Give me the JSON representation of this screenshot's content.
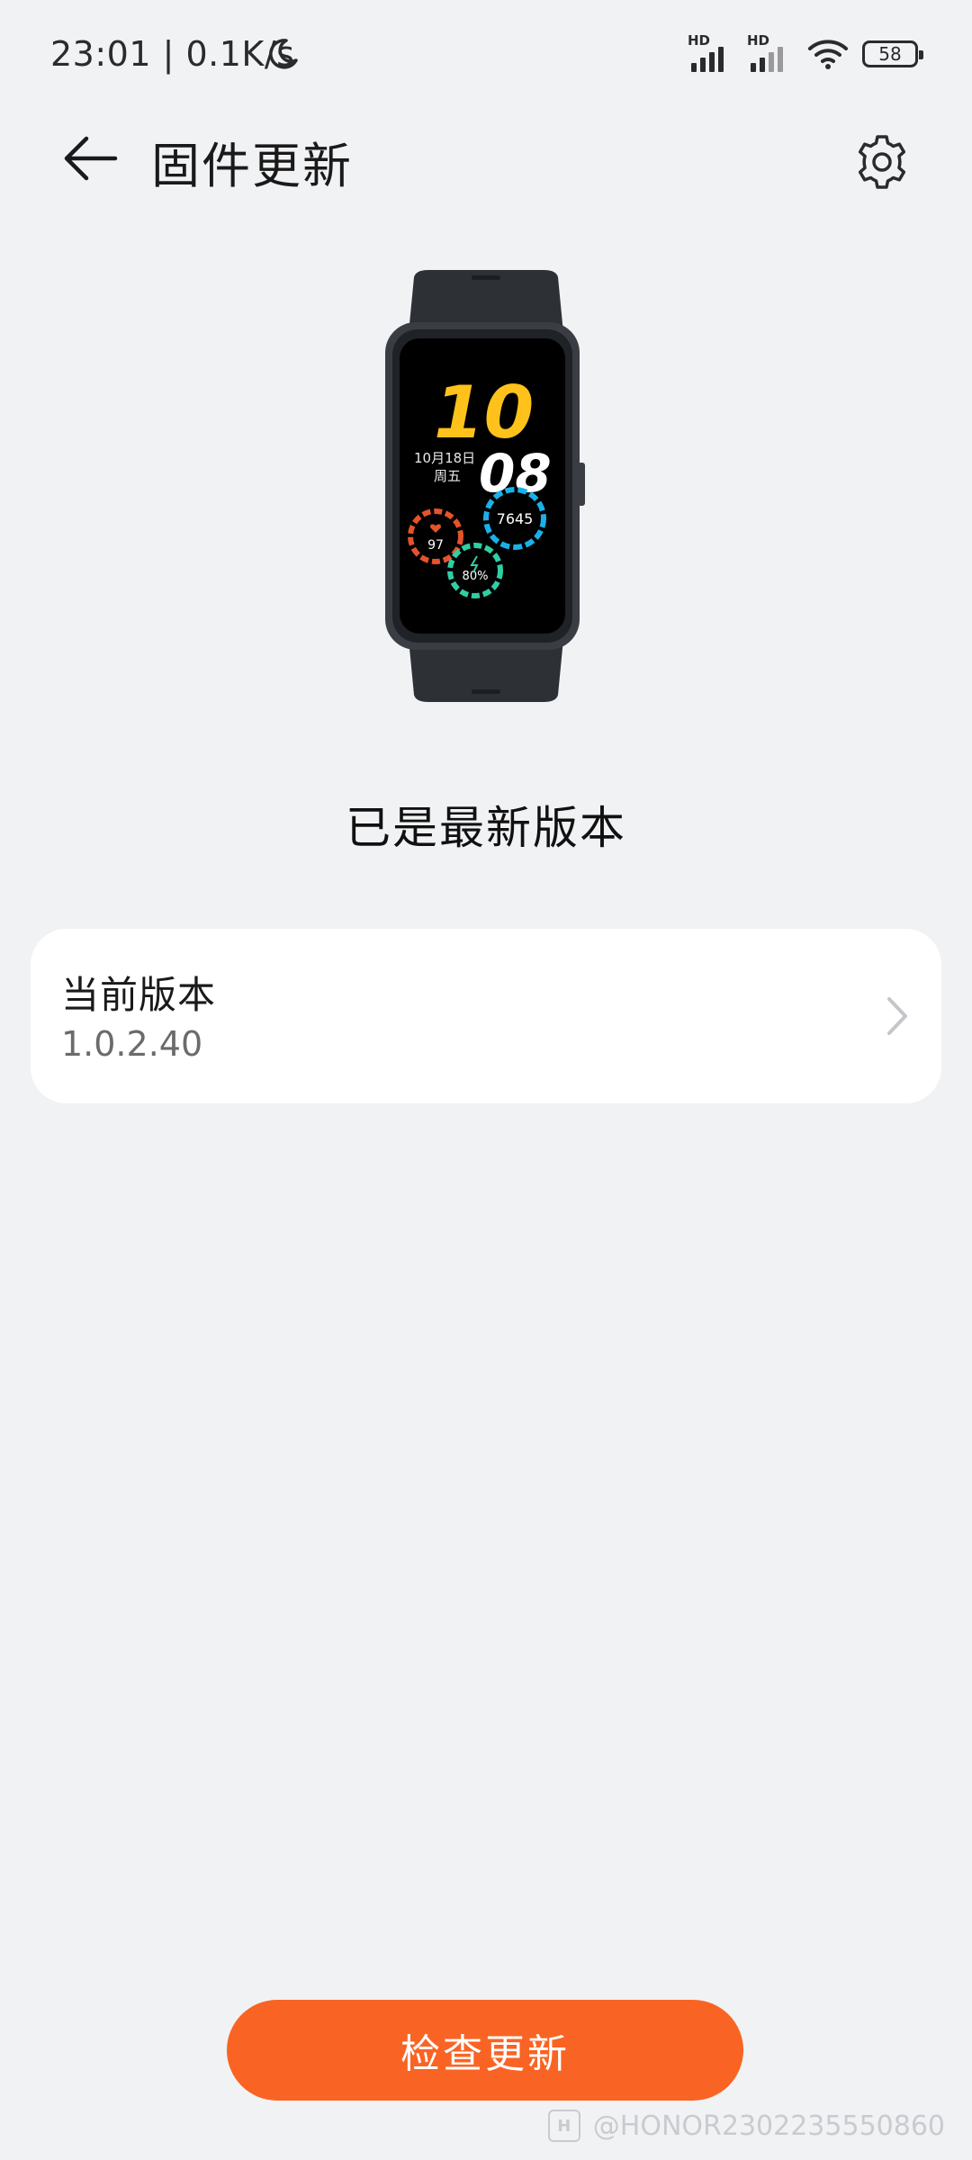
{
  "status_bar": {
    "time_speed": "23:01 | 0.1K/s",
    "battery": "58",
    "hd1": "HD",
    "hd2": "HD"
  },
  "header": {
    "title": "固件更新"
  },
  "watch_face": {
    "hour": "10",
    "minute": "08",
    "date": "10月18日",
    "weekday": "周五",
    "steps": "7645",
    "heart": "97",
    "battery": "80%"
  },
  "status": {
    "message": "已是最新版本"
  },
  "version_card": {
    "label": "当前版本",
    "value": "1.0.2.40"
  },
  "actions": {
    "check_update": "检查更新"
  },
  "watermark": {
    "text": "@HONOR2302235550860",
    "logo": "H"
  },
  "colors": {
    "accent": "#f96424",
    "background": "#f1f2f4"
  }
}
